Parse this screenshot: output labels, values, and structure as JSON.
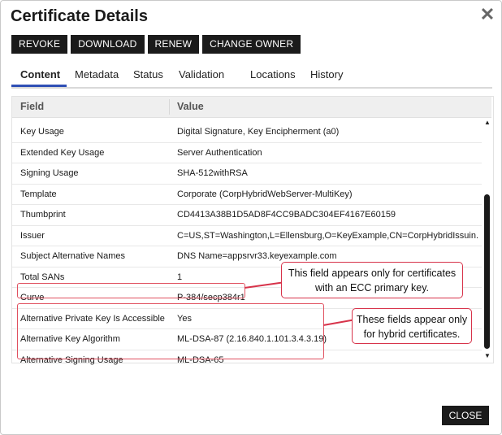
{
  "dialog": {
    "title": "Certificate Details",
    "close_icon": "close-icon"
  },
  "toolbar": {
    "revoke_label": "REVOKE",
    "download_label": "DOWNLOAD",
    "renew_label": "RENEW",
    "change_owner_label": "CHANGE OWNER"
  },
  "tabs": [
    {
      "label": "Content",
      "active": true
    },
    {
      "label": "Metadata"
    },
    {
      "label": "Status"
    },
    {
      "label": "Validation"
    },
    {
      "label": "Locations"
    },
    {
      "label": "History"
    }
  ],
  "grid": {
    "columns": [
      "Field",
      "Value"
    ],
    "rows": [
      {
        "field": "Key Usage",
        "value": "Digital Signature, Key Encipherment (a0)"
      },
      {
        "field": "Extended Key Usage",
        "value": "Server Authentication"
      },
      {
        "field": "Signing Usage",
        "value": "SHA-512withRSA"
      },
      {
        "field": "Template",
        "value": "Corporate (CorpHybridWebServer-MultiKey)"
      },
      {
        "field": "Thumbprint",
        "value": "CD4413A38B1D5AD8F4CC9BADC304EF4167E60159"
      },
      {
        "field": "Issuer",
        "value": "C=US,ST=Washington,L=Ellensburg,O=KeyExample,CN=CorpHybridIssuin..."
      },
      {
        "field": "Subject Alternative Names",
        "value": "DNS Name=appsrvr33.keyexample.com"
      },
      {
        "field": "Total SANs",
        "value": "1"
      },
      {
        "field": "Curve",
        "value": "P-384/secp384r1"
      },
      {
        "field": "Alternative Private Key Is Accessible",
        "value": "Yes"
      },
      {
        "field": "Alternative Key Algorithm",
        "value": "ML-DSA-87 (2.16.840.1.101.3.4.3.19)"
      },
      {
        "field": "Alternative Signing Usage",
        "value": "ML-DSA-65"
      }
    ]
  },
  "callouts": {
    "ecc": "This field appears only for certificates with an ECC primary key.",
    "hybrid": "These fields appear only for hybrid certificates."
  },
  "footer": {
    "close_label": "CLOSE"
  },
  "colors": {
    "accent": "#2f4fb5",
    "button_dark": "#1b1b1b",
    "callout_border": "#d7334a"
  }
}
